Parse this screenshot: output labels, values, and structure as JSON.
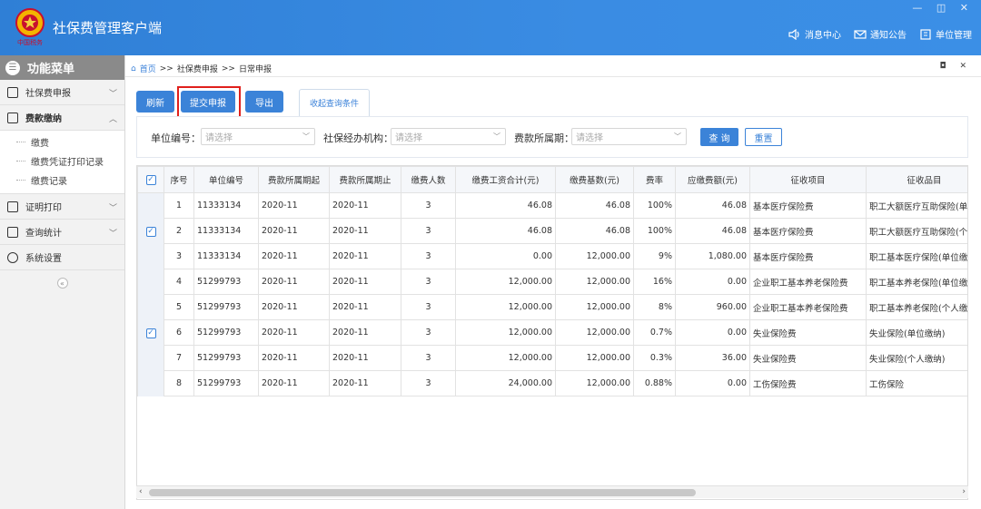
{
  "app": {
    "title": "社保费管理客户端",
    "logo_text": "中国税务",
    "window_controls": [
      "—",
      "◫",
      "✕"
    ]
  },
  "header_links": [
    {
      "label": "消息中心",
      "icon": "speaker-icon"
    },
    {
      "label": "通知公告",
      "icon": "mail-icon"
    },
    {
      "label": "单位管理",
      "icon": "building-icon"
    }
  ],
  "sidebar": {
    "title": "功能菜单",
    "items": [
      {
        "label": "社保费申报",
        "expanded": false
      },
      {
        "label": "费款缴纳",
        "expanded": true,
        "children": [
          "缴费",
          "缴费凭证打印记录",
          "缴费记录"
        ]
      },
      {
        "label": "证明打印",
        "expanded": false
      },
      {
        "label": "查询统计",
        "expanded": false
      },
      {
        "label": "系统设置",
        "expanded": false
      }
    ],
    "collapse_label": "«"
  },
  "breadcrumb": {
    "home": "首页",
    "sep": ">>",
    "level1": "社保费申报",
    "level2": "日常申报"
  },
  "tab_controls": "◘ ✕",
  "toolbar": {
    "refresh": "刷新",
    "submit": "提交申报",
    "export": "导出",
    "toggle_query": "收起查询条件"
  },
  "query": {
    "unit_no_label": "单位编号：",
    "unit_no_placeholder": "请选择",
    "agency_label": "社保经办机构：",
    "agency_placeholder": "请选择",
    "period_label": "费款所属期：",
    "period_placeholder": "请选择",
    "query_btn": "查 询",
    "reset_btn": "重置"
  },
  "table": {
    "headers": [
      "序号",
      "单位编号",
      "费款所属期起",
      "费款所属期止",
      "缴费人数",
      "缴费工资合计(元)",
      "缴费基数(元)",
      "费率",
      "应缴费额(元)",
      "征收项目",
      "征收品目"
    ],
    "rows": [
      [
        "1",
        "11333134",
        "2020-11",
        "2020-11",
        "3",
        "46.08",
        "46.08",
        "100%",
        "46.08",
        "基本医疗保险费",
        "职工大额医疗互助保险(单位..."
      ],
      [
        "2",
        "11333134",
        "2020-11",
        "2020-11",
        "3",
        "46.08",
        "46.08",
        "100%",
        "46.08",
        "基本医疗保险费",
        "职工大额医疗互助保险(个人..."
      ],
      [
        "3",
        "11333134",
        "2020-11",
        "2020-11",
        "3",
        "0.00",
        "12,000.00",
        "9%",
        "1,080.00",
        "基本医疗保险费",
        "职工基本医疗保险(单位缴纳)"
      ],
      [
        "4",
        "51299793",
        "2020-11",
        "2020-11",
        "3",
        "12,000.00",
        "12,000.00",
        "16%",
        "0.00",
        "企业职工基本养老保险费",
        "职工基本养老保险(单位缴纳)"
      ],
      [
        "5",
        "51299793",
        "2020-11",
        "2020-11",
        "3",
        "12,000.00",
        "12,000.00",
        "8%",
        "960.00",
        "企业职工基本养老保险费",
        "职工基本养老保险(个人缴纳)"
      ],
      [
        "6",
        "51299793",
        "2020-11",
        "2020-11",
        "3",
        "12,000.00",
        "12,000.00",
        "0.7%",
        "0.00",
        "失业保险费",
        "失业保险(单位缴纳)"
      ],
      [
        "7",
        "51299793",
        "2020-11",
        "2020-11",
        "3",
        "12,000.00",
        "12,000.00",
        "0.3%",
        "36.00",
        "失业保险费",
        "失业保险(个人缴纳)"
      ],
      [
        "8",
        "51299793",
        "2020-11",
        "2020-11",
        "3",
        "24,000.00",
        "12,000.00",
        "0.88%",
        "0.00",
        "工伤保险费",
        "工伤保险"
      ]
    ],
    "check_mark": "✓"
  },
  "scroll": {
    "left": "‹",
    "right": "›"
  }
}
